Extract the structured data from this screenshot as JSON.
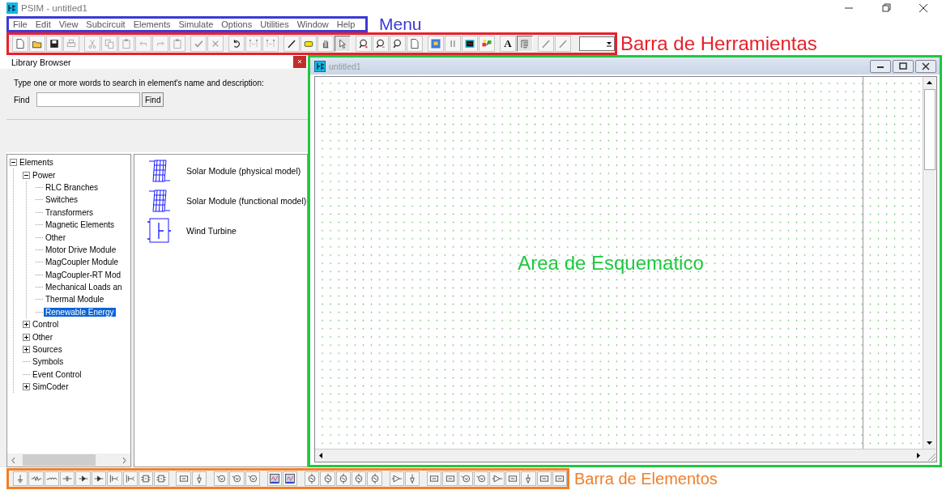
{
  "window": {
    "title": "PSIM - untitled1"
  },
  "menu": [
    "File",
    "Edit",
    "View",
    "Subcircuit",
    "Elements",
    "Simulate",
    "Options",
    "Utilities",
    "Window",
    "Help"
  ],
  "toolbar": {
    "groups": [
      [
        {
          "disabled": false,
          "pressed": false
        },
        {
          "disabled": false,
          "pressed": false
        },
        {
          "disabled": false,
          "pressed": false
        },
        {
          "disabled": true,
          "pressed": false
        }
      ],
      [
        {
          "disabled": true,
          "pressed": false
        },
        {
          "disabled": true,
          "pressed": false
        },
        {
          "disabled": true,
          "pressed": false
        },
        {
          "disabled": true,
          "pressed": false
        },
        {
          "disabled": true,
          "pressed": false
        },
        {
          "disabled": true,
          "pressed": false
        }
      ],
      [
        {
          "disabled": true,
          "pressed": false
        },
        {
          "disabled": true,
          "pressed": false
        }
      ],
      [
        {
          "disabled": false,
          "pressed": false
        },
        {
          "disabled": true,
          "pressed": false
        },
        {
          "disabled": true,
          "pressed": false
        }
      ],
      [
        {
          "disabled": false,
          "pressed": false
        },
        {
          "disabled": false,
          "pressed": false
        },
        {
          "disabled": false,
          "pressed": false
        },
        {
          "disabled": false,
          "pressed": true
        }
      ],
      [
        {
          "disabled": false,
          "pressed": false
        },
        {
          "disabled": false,
          "pressed": false
        },
        {
          "disabled": false,
          "pressed": false
        },
        {
          "disabled": false,
          "pressed": false
        }
      ],
      [
        {
          "disabled": false,
          "pressed": false
        },
        {
          "disabled": true,
          "pressed": false
        },
        {
          "disabled": false,
          "pressed": false
        },
        {
          "disabled": false,
          "pressed": false
        }
      ],
      [
        {
          "disabled": false,
          "pressed": false,
          "label": "A"
        },
        {
          "disabled": false,
          "pressed": true
        }
      ],
      [
        {
          "disabled": true,
          "pressed": false
        },
        {
          "disabled": true,
          "pressed": false
        }
      ]
    ]
  },
  "library": {
    "title": "Library Browser",
    "instructions": "Type one or more words to search in element's name and  description:",
    "find_label": "Find",
    "find_button": "Find",
    "tree": [
      {
        "label": "Elements",
        "expanded": true,
        "selected": false,
        "children": [
          {
            "label": "Power",
            "expanded": true,
            "selected": false,
            "children": [
              {
                "label": "RLC Branches",
                "selected": false
              },
              {
                "label": "Switches",
                "selected": false
              },
              {
                "label": "Transformers",
                "selected": false
              },
              {
                "label": "Magnetic Elements",
                "selected": false
              },
              {
                "label": "Other",
                "selected": false
              },
              {
                "label": "Motor Drive Module",
                "selected": false
              },
              {
                "label": "MagCoupler Module",
                "selected": false
              },
              {
                "label": "MagCoupler-RT Mod",
                "selected": false
              },
              {
                "label": "Mechanical Loads an",
                "selected": false
              },
              {
                "label": "Thermal Module",
                "selected": false
              },
              {
                "label": "Renewable Energy",
                "selected": true
              }
            ]
          },
          {
            "label": "Control",
            "expanded": false,
            "selected": false
          },
          {
            "label": "Other",
            "expanded": false,
            "selected": false
          },
          {
            "label": "Sources",
            "expanded": false,
            "selected": false
          },
          {
            "label": "Symbols",
            "selected": false
          },
          {
            "label": "Event Control",
            "selected": false
          },
          {
            "label": "SimCoder",
            "expanded": false,
            "selected": false
          }
        ]
      }
    ],
    "elements": [
      {
        "label": "Solar Module (physical model)",
        "kind": "solar"
      },
      {
        "label": "Solar Module (functional model)",
        "kind": "solar"
      },
      {
        "label": "Wind Turbine",
        "kind": "wind"
      }
    ]
  },
  "schematic": {
    "title": "untitled1"
  },
  "annotations": [
    {
      "label": "Menu",
      "color": "#3b3bd6"
    },
    {
      "label": "Barra de Herramientas",
      "color": "#e8202a"
    },
    {
      "label": "Area de Esquematico",
      "color": "#1ec840"
    },
    {
      "label": "Barra de Elementos",
      "color": "#f07f2a"
    }
  ]
}
